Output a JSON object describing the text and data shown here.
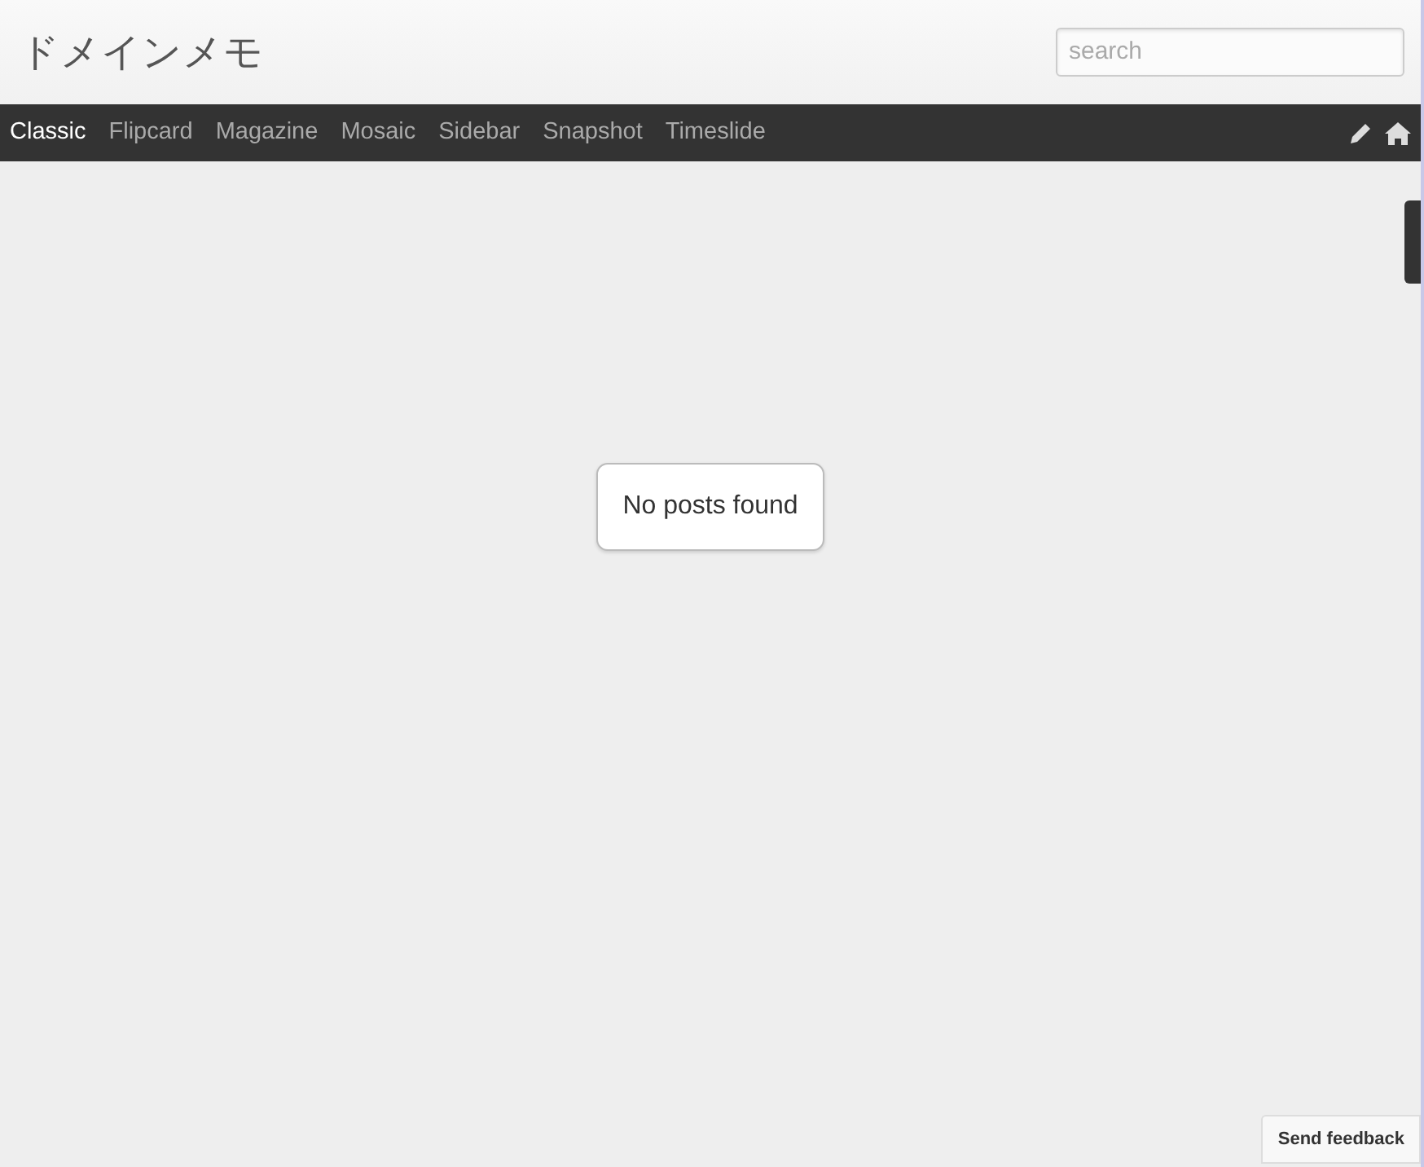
{
  "site_title": "ドメインメモ",
  "search": {
    "placeholder": "search"
  },
  "nav": [
    {
      "label": "Classic",
      "selected": true
    },
    {
      "label": "Flipcard",
      "selected": false
    },
    {
      "label": "Magazine",
      "selected": false
    },
    {
      "label": "Mosaic",
      "selected": false
    },
    {
      "label": "Sidebar",
      "selected": false
    },
    {
      "label": "Snapshot",
      "selected": false
    },
    {
      "label": "Timeslide",
      "selected": false
    }
  ],
  "message": "No posts found",
  "feedback_button": "Send feedback"
}
